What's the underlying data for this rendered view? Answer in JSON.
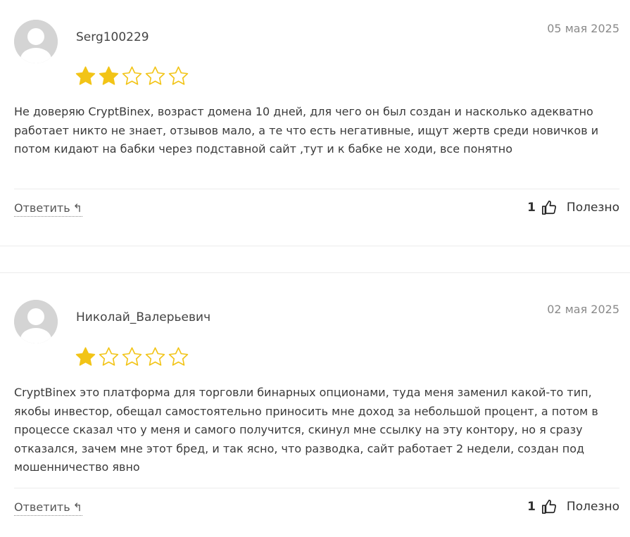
{
  "reviews": [
    {
      "author": "Serg100229",
      "date": "05 мая 2025",
      "rating": 2,
      "max_rating": 5,
      "text": "Не доверяю CryptBinex, возраст домена 10 дней, для чего он был создан и насколько адекватно работает никто не знает, отзывов мало, а те что есть негативные, ищут жертв среди новичков и потом кидают на бабки через подставной сайт ,тут и к бабке не ходи, все понятно",
      "reply_label": "Ответить",
      "helpful_count": "1",
      "helpful_label": "Полезно"
    },
    {
      "author": "Николай_Валерьевич",
      "date": "02 мая 2025",
      "rating": 1,
      "max_rating": 5,
      "text": "CryptBinex это платформа для торговли бинарных опционами, туда меня заменил какой-то тип, якобы инвестор, обещал самостоятельно приносить мне доход за небольшой процент, а потом в процессе сказал что у меня и самого получится, скинул мне ссылку на эту контору, но я сразу отказался, зачем мне этот бред, и так ясно, что разводка, сайт работает 2 недели, создан под мошенничество явно",
      "reply_label": "Ответить",
      "helpful_count": "1",
      "helpful_label": "Полезно"
    }
  ],
  "colors": {
    "star_filled": "#f2c417",
    "star_empty_outline": "#f2c417",
    "date": "#8a8a8a",
    "avatar_bg": "#d4d4d4"
  },
  "icons": {
    "reply": "reply-arrow-icon",
    "helpful": "thumbs-up-icon",
    "avatar": "user-avatar-icon",
    "star": "star-icon"
  }
}
